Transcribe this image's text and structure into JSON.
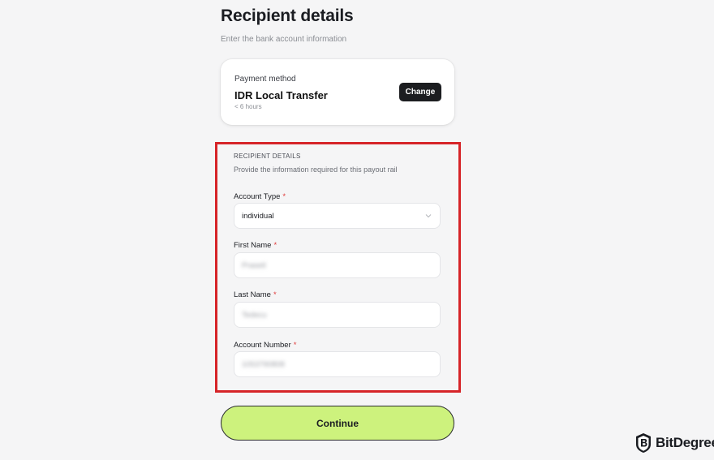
{
  "page": {
    "title": "Recipient details",
    "subtitle": "Enter the bank account information"
  },
  "payment": {
    "label": "Payment method",
    "method": "IDR Local Transfer",
    "eta": "< 6 hours",
    "change_label": "Change"
  },
  "recipient": {
    "section_title": "RECIPIENT DETAILS",
    "section_desc": "Provide the information required for this payout rail",
    "required_mark": "*",
    "fields": [
      {
        "label": "Account Type",
        "value": "individual",
        "type": "select"
      },
      {
        "label": "First Name",
        "value": "Prasetl",
        "blurred": true
      },
      {
        "label": "Last Name",
        "value": "Tedecu",
        "blurred": true
      },
      {
        "label": "Account Number",
        "value": "1053790808",
        "blurred": true
      }
    ]
  },
  "actions": {
    "continue_label": "Continue"
  },
  "watermark": {
    "brand": "BitDegree"
  },
  "colors": {
    "accent": "#cdf27d",
    "highlight": "#d62428",
    "required": "#e03a3a"
  }
}
